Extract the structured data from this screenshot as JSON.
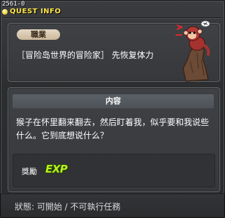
{
  "window": {
    "quest_id": "2561-0",
    "title": "QUEST INFO"
  },
  "quest": {
    "job_label": "職業",
    "name": "［冒险岛世界的冒险家］ 先恢复体力",
    "npc_icon": "monkey-on-tree-stump"
  },
  "content": {
    "header": "内容",
    "description": "猴子在怀里翻来翻去，然后盯着我，似乎要和我说些什么。它到底想说什么？"
  },
  "reward": {
    "label": "獎勵",
    "exp_text": "EXP"
  },
  "status": {
    "text": "狀態: 可開始 / 不可執行任務"
  },
  "colors": {
    "title": "#ffe54a",
    "exp": "#b7f021",
    "panel_border": "#65686c"
  }
}
